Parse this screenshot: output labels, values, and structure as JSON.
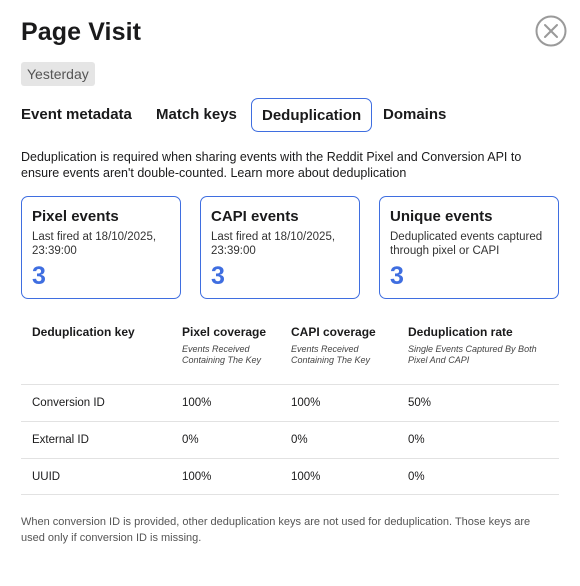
{
  "header": {
    "title": "Page Visit",
    "date": "Yesterday"
  },
  "tabs": [
    {
      "label": "Event metadata"
    },
    {
      "label": "Match keys"
    },
    {
      "label": "Deduplication"
    },
    {
      "label": "Domains"
    }
  ],
  "active_tab": "Deduplication",
  "description": "Deduplication is required when sharing events with the Reddit Pixel and Conversion API to ensure events aren't double-counted. Learn more about deduplication",
  "cards": [
    {
      "title": "Pixel events",
      "subtitle": "Last fired at 18/10/2025, 23:39:00",
      "value": "3"
    },
    {
      "title": "CAPI events",
      "subtitle": "Last fired at 18/10/2025, 23:39:00",
      "value": "3"
    },
    {
      "title": "Unique events",
      "subtitle": "Deduplicated events captured through pixel or CAPI",
      "value": "3"
    }
  ],
  "table": {
    "headers": [
      {
        "label": "Deduplication key",
        "sub": ""
      },
      {
        "label": "Pixel coverage",
        "sub": "Events Received Containing The Key"
      },
      {
        "label": "CAPI coverage",
        "sub": "Events Received Containing The Key"
      },
      {
        "label": "Deduplication rate",
        "sub": "Single Events Captured By Both Pixel And CAPI"
      }
    ],
    "rows": [
      [
        "Conversion ID",
        "100%",
        "100%",
        "50%"
      ],
      [
        "External ID",
        "0%",
        "0%",
        "0%"
      ],
      [
        "UUID",
        "100%",
        "100%",
        "0%"
      ]
    ]
  },
  "footnote": "When conversion ID is provided, other deduplication keys are not used for deduplication. Those keys are used only if conversion ID is missing.",
  "colors": {
    "accent": "#3f6ee0",
    "badge_bg": "#e5e5e5",
    "divider": "#e2e2e2"
  },
  "icons": {
    "close": "close-circle-icon"
  }
}
